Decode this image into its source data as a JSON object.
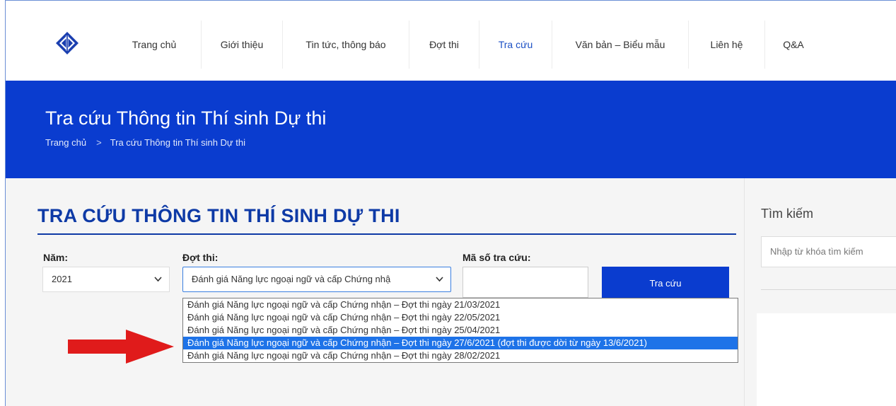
{
  "nav": {
    "items": [
      {
        "label": "Trang chủ"
      },
      {
        "label": "Giới thiệu"
      },
      {
        "label": "Tin tức, thông báo"
      },
      {
        "label": "Đợt thi"
      },
      {
        "label": "Tra cứu",
        "active": true
      },
      {
        "label": "Văn bản – Biểu mẫu"
      },
      {
        "label": "Liên hệ"
      },
      {
        "label": "Q&A"
      }
    ]
  },
  "banner": {
    "title": "Tra cứu Thông tin Thí sinh Dự thi",
    "breadcrumb": {
      "home": "Trang chủ",
      "separator": ">",
      "current": "Tra cứu Thông tin Thí sinh Dự thi"
    }
  },
  "form": {
    "section_title": "TRA CỨU THÔNG TIN THÍ SINH DỰ THI",
    "year_label": "Năm:",
    "year_value": "2021",
    "round_label": "Đợt thi:",
    "round_value": "Đánh giá Năng lực ngoại ngữ và cấp Chứng nhậ",
    "code_label": "Mã số tra cứu:",
    "code_value": "",
    "search_button": "Tra cứu",
    "round_options": [
      "Đánh giá Năng lực ngoại ngữ và cấp Chứng nhận – Đợt thi ngày 21/03/2021",
      "Đánh giá Năng lực ngoại ngữ và cấp Chứng nhận – Đợt thi ngày 22/05/2021",
      "Đánh giá Năng lực ngoại ngữ và cấp Chứng nhận – Đợt thi ngày 25/04/2021",
      "Đánh giá Năng lực ngoại ngữ và cấp Chứng nhận – Đợt thi ngày 27/6/2021 (đợt thi được dời từ ngày 13/6/2021)",
      "Đánh giá Năng lực ngoại ngữ và cấp Chứng nhận – Đợt thi ngày 28/02/2021"
    ],
    "selected_option_index": 3
  },
  "sidebar": {
    "search_title": "Tìm kiếm",
    "search_placeholder": "Nhập từ khóa tìm kiếm"
  },
  "colors": {
    "brand_blue": "#0a3ccf",
    "title_blue": "#0e3aa6",
    "selection_blue": "#1e73e8",
    "arrow_red": "#e01b1b"
  },
  "icons": {
    "logo": "diamond-logo-icon",
    "chevron": "chevron-down-icon",
    "annotation": "red-arrow-icon"
  }
}
